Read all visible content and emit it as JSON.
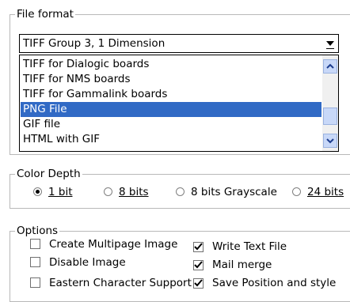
{
  "file_format": {
    "legend": "File format",
    "selected": "TIFF Group 3, 1 Dimension",
    "items": [
      "TIFF for Dialogic boards",
      "TIFF for NMS boards",
      "TIFF for Gammalink boards",
      "PNG File",
      "GIF file",
      "HTML with GIF"
    ],
    "highlighted_item": "PNG File"
  },
  "color_depth": {
    "legend": "Color Depth",
    "options": [
      {
        "label": "1 bit",
        "checked": true
      },
      {
        "label": "8 bits",
        "checked": false
      },
      {
        "label": "8 bits Grayscale",
        "checked": false
      },
      {
        "label": "24 bits",
        "checked": false
      }
    ]
  },
  "options": {
    "legend": "Options",
    "left": [
      {
        "label": "Create Multipage Image",
        "checked": false
      },
      {
        "label": "Disable Image",
        "checked": false
      },
      {
        "label": "Eastern Character Support",
        "checked": false
      }
    ],
    "right": [
      {
        "label": "Write Text File",
        "checked": true
      },
      {
        "label": "Mail merge",
        "checked": true
      },
      {
        "label": "Save Position and style",
        "checked": true
      }
    ]
  },
  "colors": {
    "selection": "#316ac5",
    "scrollbar": "#c8d8f8"
  }
}
